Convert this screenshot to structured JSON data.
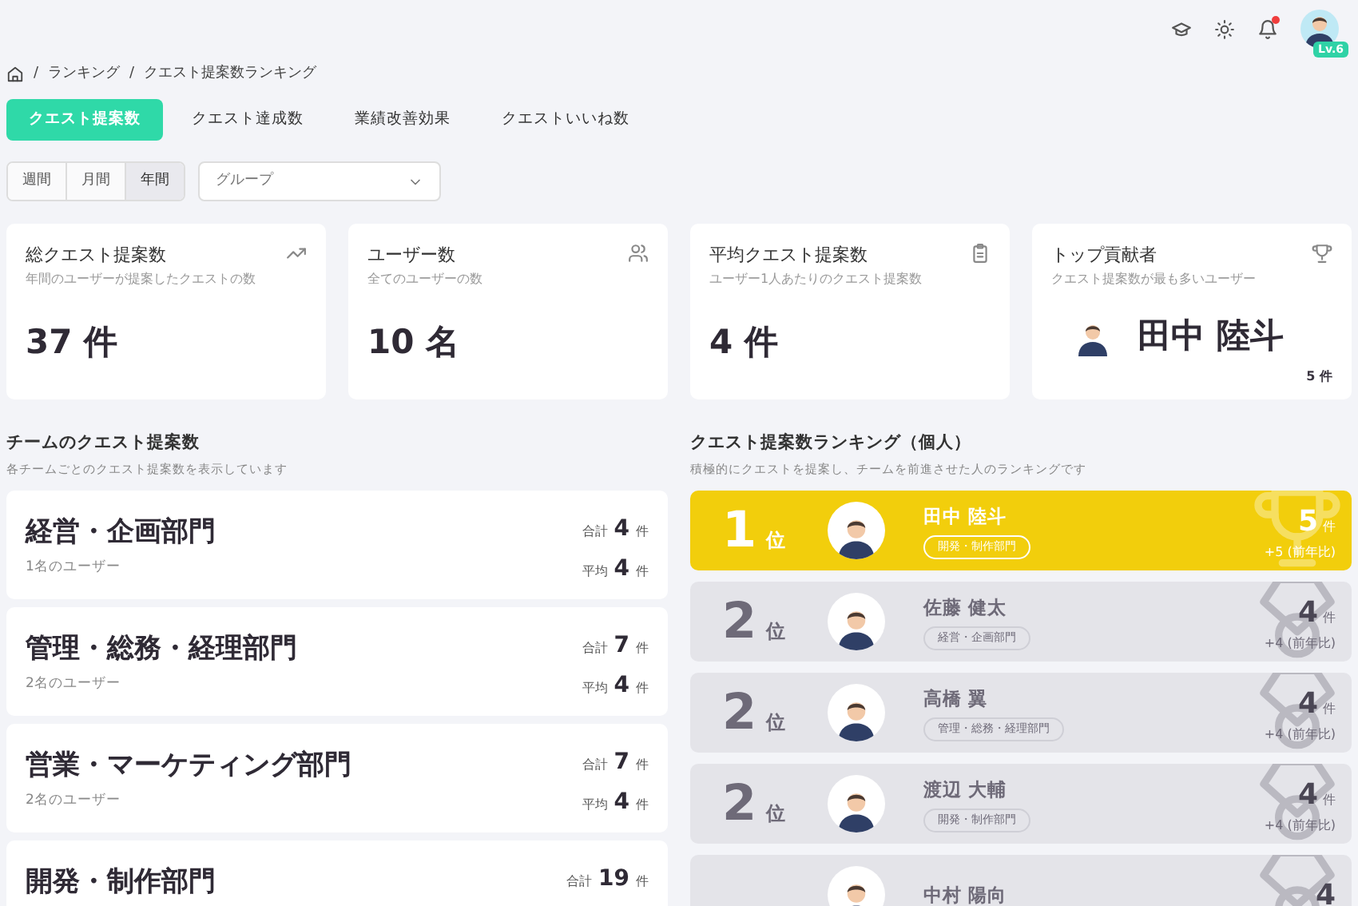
{
  "header": {
    "has_notification": true,
    "level_badge": "Lv.6"
  },
  "breadcrumb": {
    "separator": "/",
    "items": [
      "ランキング",
      "クエスト提案数ランキング"
    ]
  },
  "tabs": [
    {
      "label": "クエスト提案数",
      "selected": true
    },
    {
      "label": "クエスト達成数",
      "selected": false
    },
    {
      "label": "業績改善効果",
      "selected": false
    },
    {
      "label": "クエストいいね数",
      "selected": false
    }
  ],
  "periods": [
    {
      "label": "週間",
      "selected": false
    },
    {
      "label": "月間",
      "selected": false
    },
    {
      "label": "年間",
      "selected": true
    }
  ],
  "group_select": {
    "placeholder": "グループ"
  },
  "stats": [
    {
      "kind": "number",
      "title": "総クエスト提案数",
      "subtitle": "年間のユーザーが提案したクエストの数",
      "value": "37",
      "unit": "件"
    },
    {
      "kind": "number",
      "title": "ユーザー数",
      "subtitle": "全てのユーザーの数",
      "value": "10",
      "unit": "名"
    },
    {
      "kind": "number",
      "title": "平均クエスト提案数",
      "subtitle": "ユーザー1人あたりのクエスト提案数",
      "value": "4",
      "unit": "件"
    },
    {
      "kind": "user",
      "title": "トップ貢献者",
      "subtitle": "クエスト提案数が最も多いユーザー",
      "value": "田中 陸斗",
      "note": "5 件"
    }
  ],
  "teams": {
    "title": "チームのクエスト提案数",
    "subtitle": "各チームごとのクエスト提案数を表示しています",
    "items": [
      {
        "name": "経営・企画部門",
        "users": "1名のユーザー",
        "total_label": "合計",
        "total": "4",
        "total_unit": "件",
        "avg_label": "平均",
        "avg": "4",
        "avg_unit": "件"
      },
      {
        "name": "管理・総務・経理部門",
        "users": "2名のユーザー",
        "total_label": "合計",
        "total": "7",
        "total_unit": "件",
        "avg_label": "平均",
        "avg": "4",
        "avg_unit": "件"
      },
      {
        "name": "営業・マーケティング部門",
        "users": "2名のユーザー",
        "total_label": "合計",
        "total": "7",
        "total_unit": "件",
        "avg_label": "平均",
        "avg": "4",
        "avg_unit": "件"
      },
      {
        "name": "開発・制作部門",
        "total_label": "合計",
        "total": "19",
        "total_unit": "件"
      }
    ]
  },
  "ranking": {
    "title": "クエスト提案数ランキング（個人）",
    "subtitle": "積極的にクエストを提案し、チームを前進させた人のランキングです",
    "items": [
      {
        "kind": "gold",
        "rank": "1",
        "rank_unit": "位",
        "name": "田中 陸斗",
        "team": "開発・制作部門",
        "count": "5",
        "count_unit": "件",
        "change": "+5 (前年比)"
      },
      {
        "kind": "silver",
        "rank": "2",
        "rank_unit": "位",
        "name": "佐藤 健太",
        "team": "経営・企画部門",
        "count": "4",
        "count_unit": "件",
        "change": "+4 (前年比)"
      },
      {
        "kind": "silver",
        "rank": "2",
        "rank_unit": "位",
        "name": "高橋 翼",
        "team": "管理・総務・経理部門",
        "count": "4",
        "count_unit": "件",
        "change": "+4 (前年比)"
      },
      {
        "kind": "silver",
        "rank": "2",
        "rank_unit": "位",
        "name": "渡辺 大輔",
        "team": "開発・制作部門",
        "count": "4",
        "count_unit": "件",
        "change": "+4 (前年比)"
      },
      {
        "kind": "silver",
        "name": "中村 陽向",
        "count": "4"
      }
    ]
  }
}
